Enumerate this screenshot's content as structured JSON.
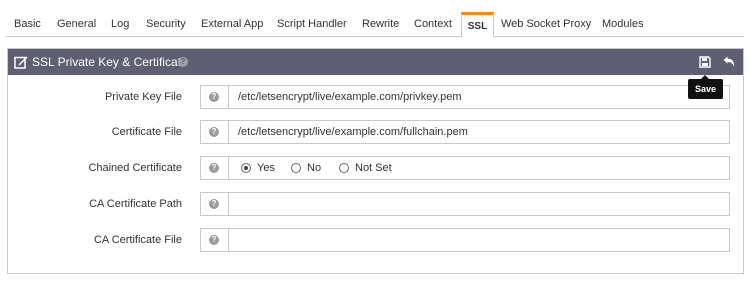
{
  "tabs": [
    {
      "label": "Basic"
    },
    {
      "label": "General"
    },
    {
      "label": "Log"
    },
    {
      "label": "Security"
    },
    {
      "label": "External App"
    },
    {
      "label": "Script Handler"
    },
    {
      "label": "Rewrite"
    },
    {
      "label": "Context"
    },
    {
      "label": "SSL",
      "active": true
    },
    {
      "label": "Web Socket Proxy"
    },
    {
      "label": "Modules"
    }
  ],
  "panel": {
    "title": "SSL Private Key & Certificate",
    "help_glyph": "?",
    "save_tooltip": "Save",
    "icons": [
      "edit-icon",
      "help-icon",
      "save-icon",
      "undo-icon"
    ],
    "header_color": "#5e6071",
    "accent_color": "#f08c1a"
  },
  "fields": {
    "private_key": {
      "label": "Private Key File",
      "value": "/etc/letsencrypt/live/example.com/privkey.pem"
    },
    "certificate": {
      "label": "Certificate File",
      "value": "/etc/letsencrypt/live/example.com/fullchain.pem"
    },
    "chained": {
      "label": "Chained Certificate",
      "options": [
        "Yes",
        "No",
        "Not Set"
      ],
      "selected": "Yes"
    },
    "ca_path": {
      "label": "CA Certificate Path",
      "value": ""
    },
    "ca_file": {
      "label": "CA Certificate File",
      "value": ""
    }
  }
}
